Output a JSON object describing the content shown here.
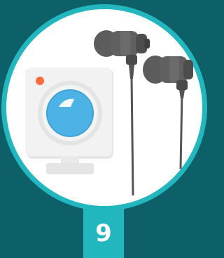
{
  "badge": {
    "number": "9"
  },
  "colors": {
    "background": "#0e6068",
    "ring": "#22b7bf",
    "disc": "#ffffff",
    "camera_body": "#f0f0f0",
    "camera_lens": "#4db3e6",
    "camera_led": "#ff6b3d",
    "earphones": "#5a5a5a"
  },
  "icons": {
    "webcam": "webcam-icon",
    "earphones": "earphones-icon"
  }
}
